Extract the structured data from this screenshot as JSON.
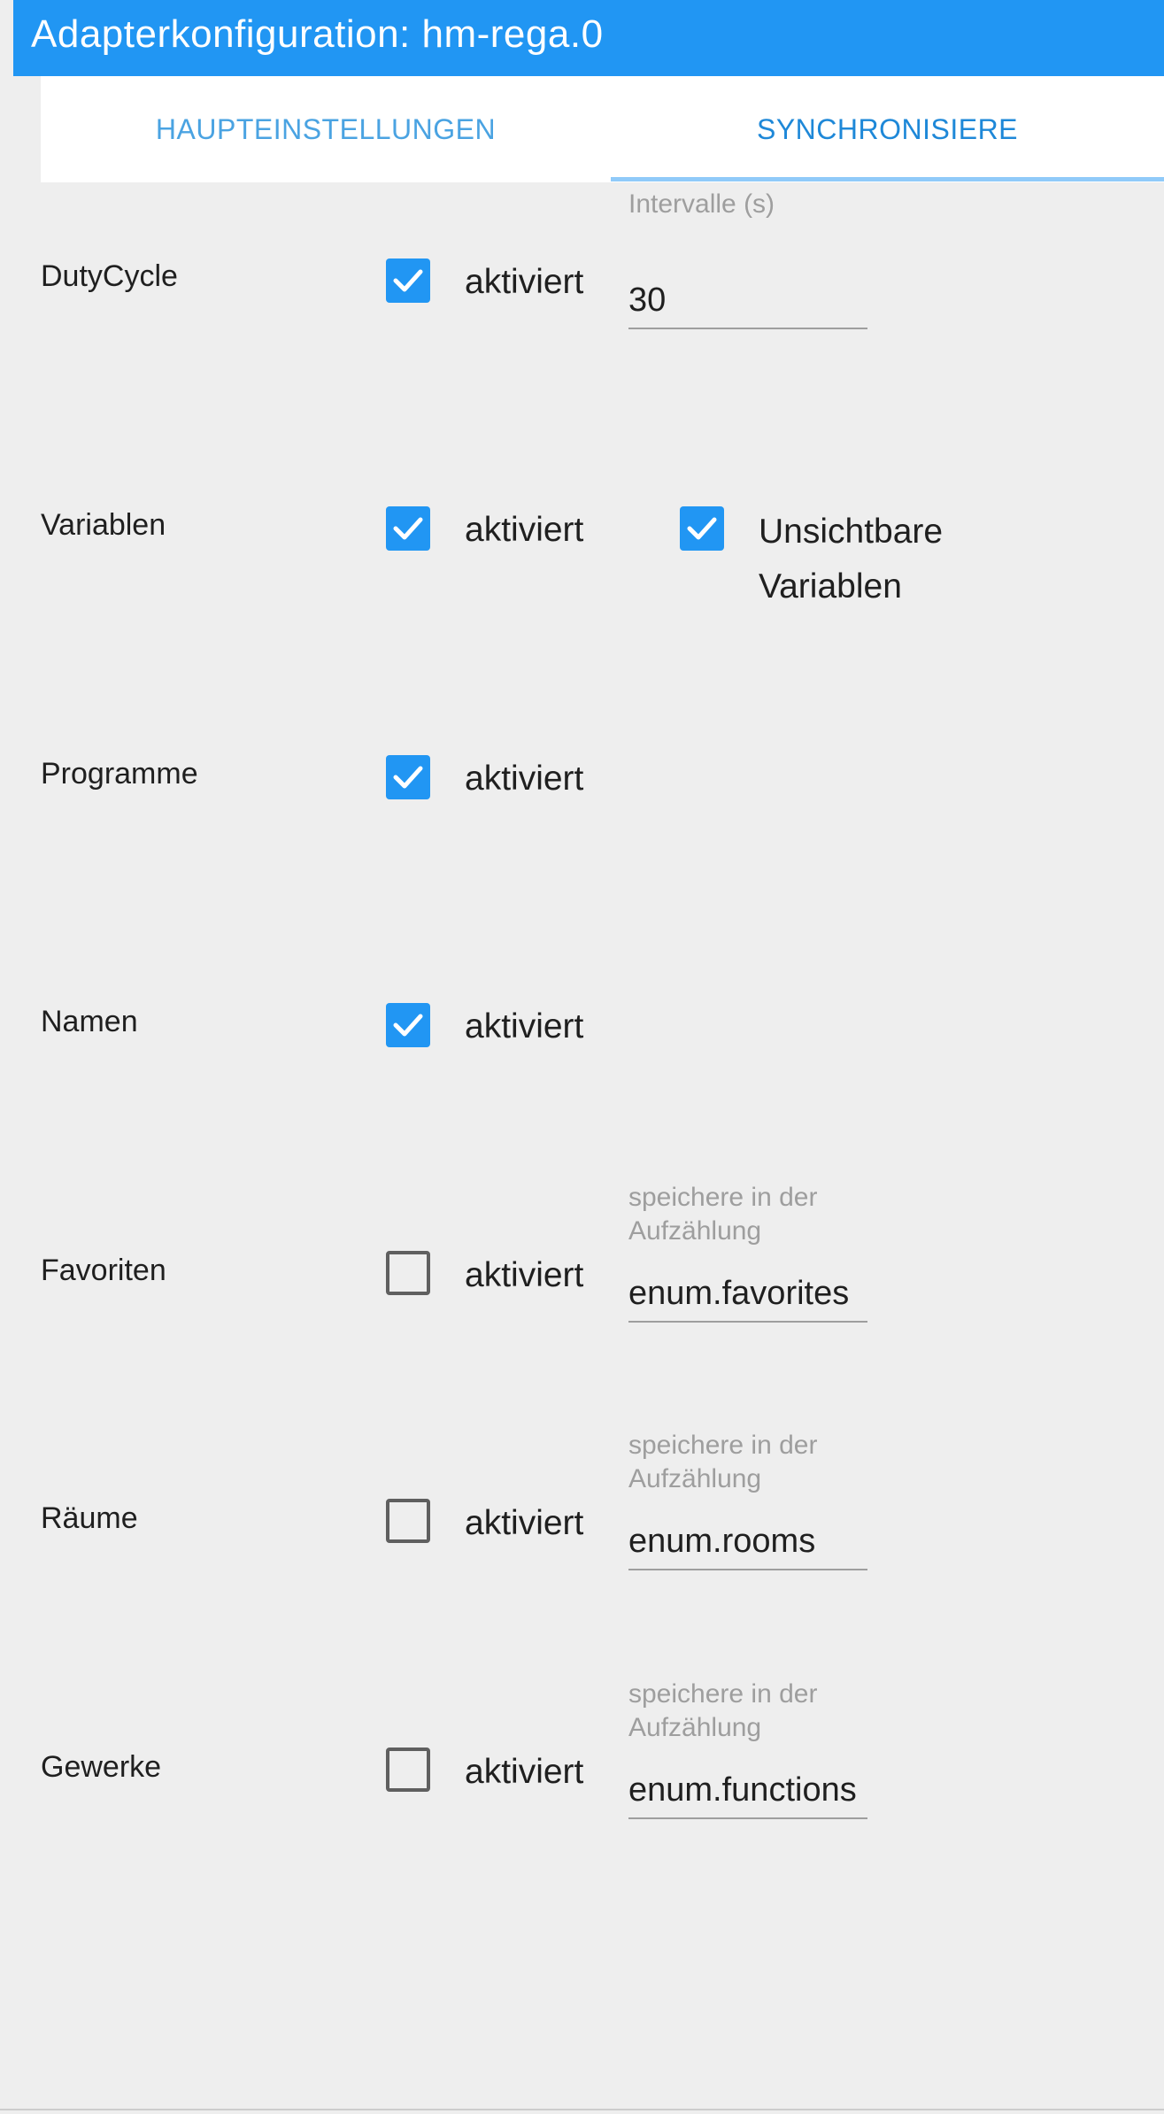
{
  "title": "Adapterkonfiguration: hm-rega.0",
  "tabs": [
    {
      "label": "HAUPTEINSTELLUNGEN",
      "active": false
    },
    {
      "label": "SYNCHRONISIERE",
      "active": true
    }
  ],
  "checkbox_label": "aktiviert",
  "colors": {
    "accent": "#2196f3",
    "background": "#eeeeee"
  },
  "rows": {
    "dutycycle": {
      "label": "DutyCycle",
      "checked": true,
      "field_label": "Intervalle (s)",
      "field_value": "30"
    },
    "variablen": {
      "label": "Variablen",
      "checked": true,
      "extra_checked": true,
      "extra_label": "Unsichtbare Variablen"
    },
    "programme": {
      "label": "Programme",
      "checked": true
    },
    "namen": {
      "label": "Namen",
      "checked": true
    },
    "favoriten": {
      "label": "Favoriten",
      "checked": false,
      "field_label": "speichere in der Aufzählung",
      "field_value": "enum.favorites"
    },
    "raeume": {
      "label": "Räume",
      "checked": false,
      "field_label": "speichere in der Aufzählung",
      "field_value": "enum.rooms"
    },
    "gewerke": {
      "label": "Gewerke",
      "checked": false,
      "field_label": "speichere in der Aufzählung",
      "field_value": "enum.functions"
    }
  }
}
